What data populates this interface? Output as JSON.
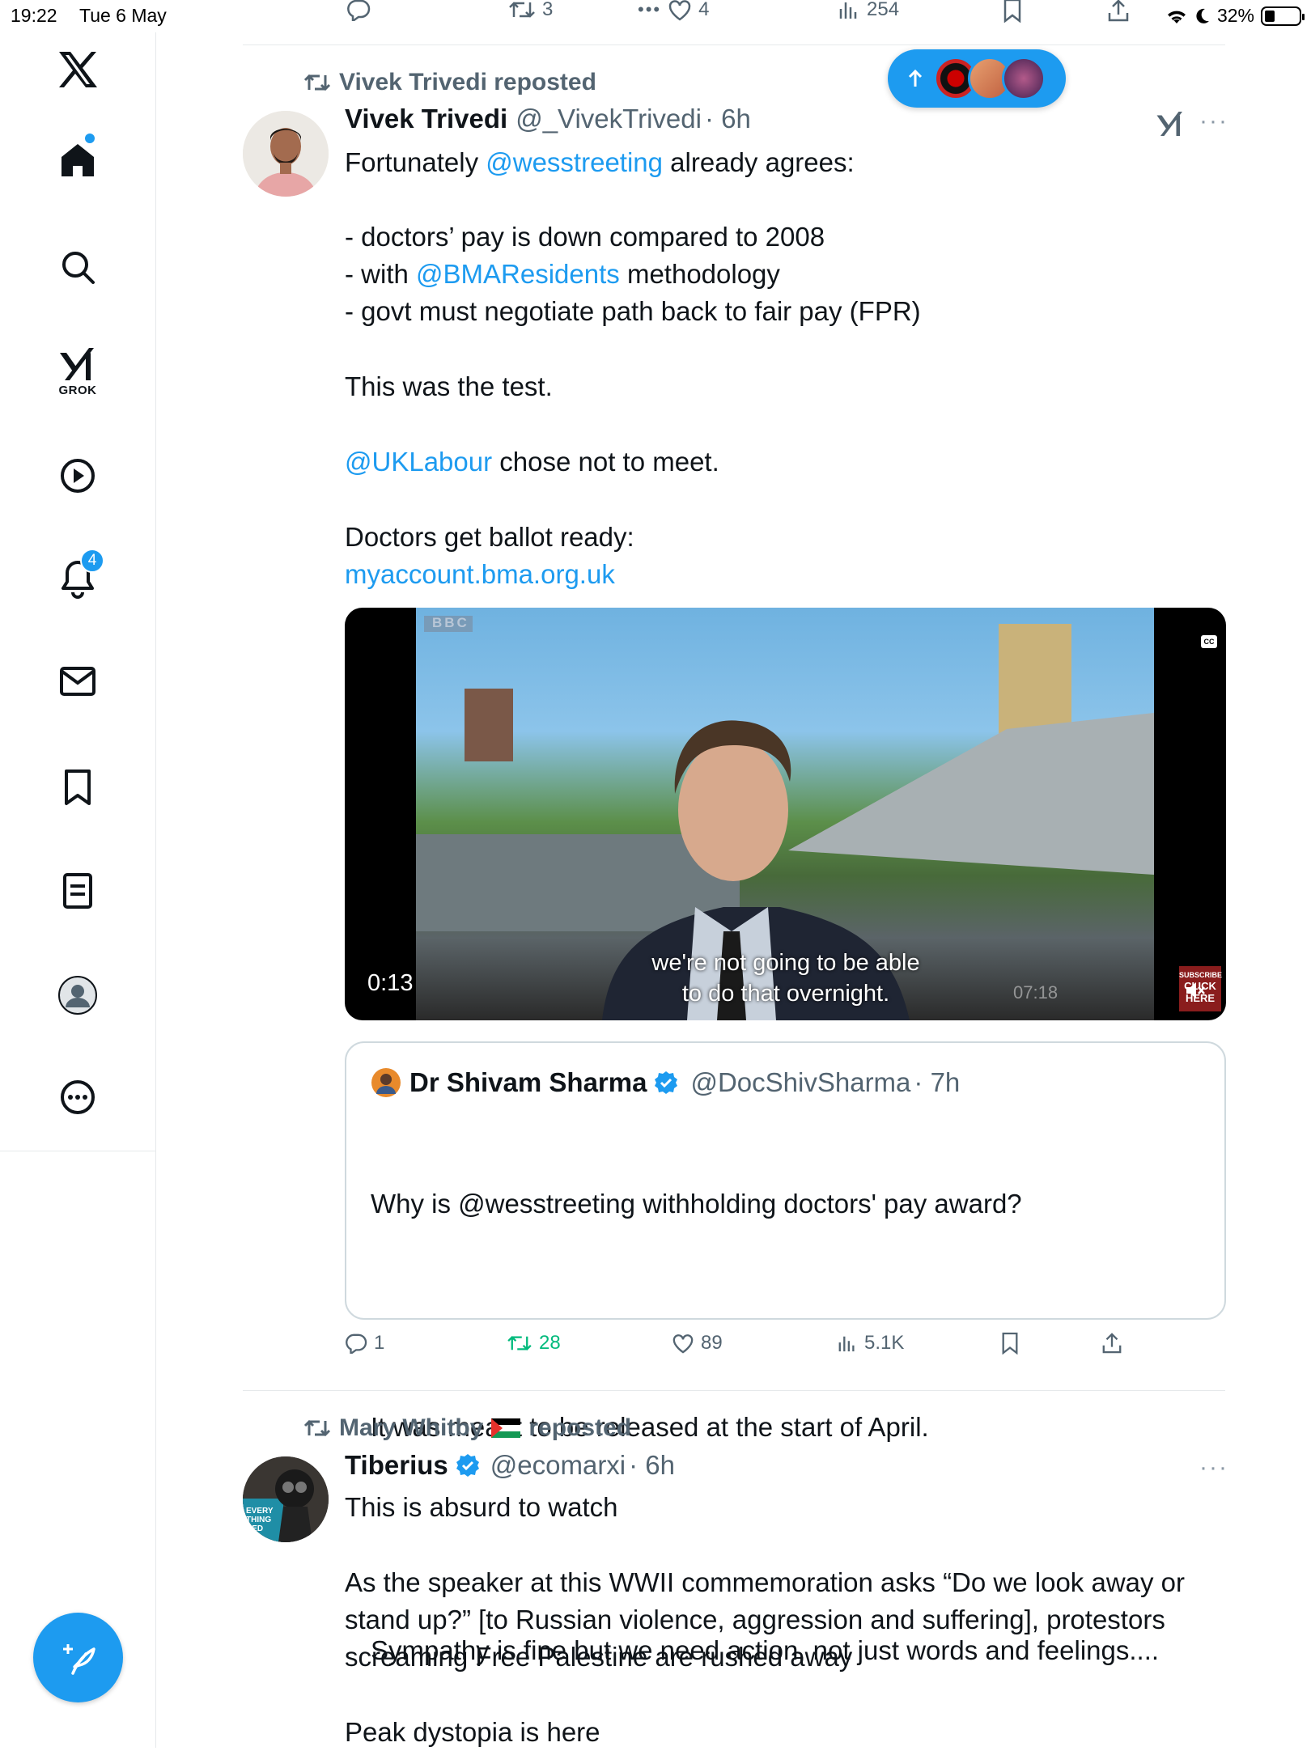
{
  "status_bar": {
    "time": "19:22",
    "date": "Tue 6 May",
    "battery": "32%"
  },
  "sidebar": {
    "grok_label": "GROK",
    "notifications_count": "4"
  },
  "prev_tweet_actions": {
    "reposts": "3",
    "likes": "4",
    "views": "254"
  },
  "tweet1": {
    "repost_by": "Vivek Trivedi reposted",
    "name": "Vivek Trivedi",
    "handle": "@_VivekTrivedi",
    "time": "· 6h",
    "line1_mention": "@wesstreeting",
    "line1_a": "Fortunately ",
    "line1_b": " already agrees:",
    "bullet1": "- doctors’ pay is down compared to 2008",
    "bullet2_a": "- with ",
    "bullet2_mention": "@BMAResidents",
    "bullet2_b": " methodology",
    "bullet3": "- govt must negotiate path back to fair pay (FPR)",
    "p2": "This was the test.",
    "p3_mention": "@UKLabour",
    "p3_b": " chose not to meet.",
    "p4": "Doctors get ballot ready:",
    "p4_link": "myaccount.bma.org.uk",
    "video": {
      "duration": "0:13",
      "subtitle_1": "we're not going to be able",
      "subtitle_2": "to do that overnight.",
      "watermark": "07:18",
      "bbc": "BBC",
      "cc": "CC",
      "subscribe": "SUBSCRIBE",
      "click_here": "CLICK HERE"
    },
    "quote": {
      "name": "Dr Shivam Sharma",
      "handle": "@DocShivSharma",
      "time": "· 7h",
      "text1": "Why is @wesstreeting withholding doctors' pay award?",
      "text2": "It was meant to be released at the start of April.",
      "text3": "Sympathy is fine but we need action, not just words and feelings...."
    },
    "actions": {
      "replies": "1",
      "reposts": "28",
      "likes": "89",
      "views": "5.1K"
    }
  },
  "tweet2": {
    "repost_by": "Mary Whitby",
    "repost_suffix": "reposted",
    "name": "Tiberius",
    "handle": "@ecomarxi",
    "time": "· 6h",
    "p1": "This is absurd to watch",
    "p2": "As the speaker at this WWII commemoration asks “Do we look away or stand up?” [to Russian violence, aggression and suffering], protestors screaming Free Palestine are rushed away",
    "p3": "Peak dystopia is here",
    "avatar_text": "EVERY THING KED"
  },
  "colors": {
    "accent": "#1d9bf0",
    "repost_green": "#00ba7c",
    "muted": "#536471"
  }
}
